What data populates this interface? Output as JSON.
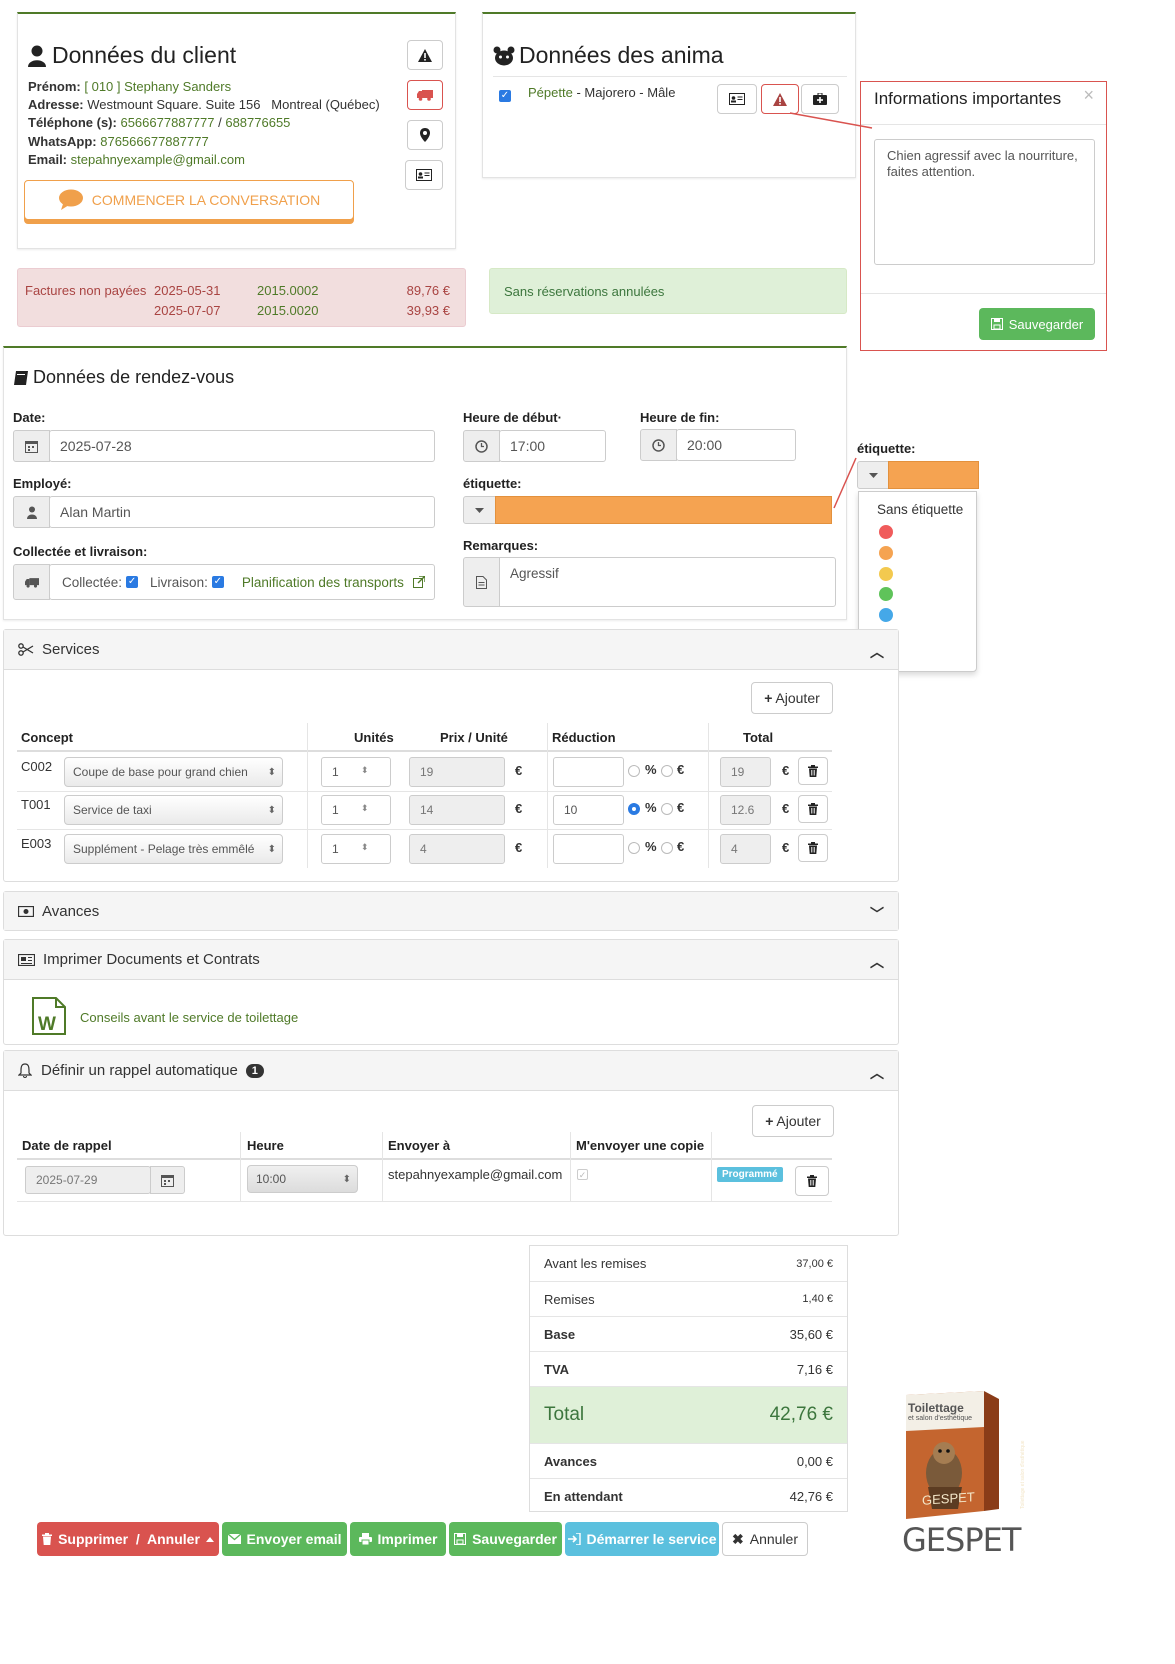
{
  "client": {
    "title": "Données du client",
    "prenom_label": "Prénom:",
    "prenom_value": "[ 010 ] Stephany Sanders",
    "adresse_label": "Adresse:",
    "adresse_value": "Westmount Square. Suite 156   Montreal (Québec)",
    "tel_label": "Téléphone (s):",
    "tel1": "6566677887777",
    "tel_sep": "/",
    "tel2": "688776655",
    "whatsapp_label": "WhatsApp:",
    "whatsapp_value": "876566677887777",
    "email_label": "Email:",
    "email_value": "stepahnyexample@gmail.com",
    "conversation_button": "COMMENCER LA CONVERSATION"
  },
  "animals": {
    "title": "Données des anima",
    "pet_name": "Pépette",
    "pet_details": "- Majorero - Mâle"
  },
  "important": {
    "title": "Informations importantes",
    "close": "×",
    "note": "Chien agressif avec la nourriture, faites attention.",
    "save_button": "Sauvegarder"
  },
  "invoices": {
    "label": "Factures non payées",
    "rows": [
      {
        "date": "2025-05-31",
        "number": "2015.0002",
        "amount": "89,76 €"
      },
      {
        "date": "2025-07-07",
        "number": "2015.0020",
        "amount": "39,93 €"
      }
    ]
  },
  "cancellations": {
    "text": "Sans réservations annulées"
  },
  "appointment": {
    "title": "Données de rendez-vous",
    "date_label": "Date:",
    "date_value": "2025-07-28",
    "start_label": "Heure de début·",
    "start_value": "17:00",
    "end_label": "Heure de fin:",
    "end_value": "20:00",
    "employee_label": "Employé:",
    "employee_value": "Alan Martin",
    "tag_label": "étiquette:",
    "tag_color": "#f5a351",
    "pickup_label": "Collectée et livraison:",
    "collected_label": "Collectée:",
    "delivery_label": "Livraison:",
    "transport_link": "Planification des transports",
    "remarks_label": "Remarques:",
    "remarks_value": "Agressif"
  },
  "tag_dropdown": {
    "label": "étiquette:",
    "none_option": "Sans étiquette",
    "colors": [
      "#f05b5b",
      "#f5a351",
      "#f3c94f",
      "#5fc35a",
      "#45a8e8",
      "#d07ee0",
      "#9e9e9e"
    ]
  },
  "services": {
    "title": "Services",
    "add_button": "Ajouter",
    "headers": {
      "concept": "Concept",
      "units": "Unités",
      "unit_price": "Prix / Unité",
      "discount": "Réduction",
      "total": "Total"
    },
    "rows": [
      {
        "code": "C002",
        "service": "Coupe de base pour grand chien",
        "units": "1",
        "price": "19",
        "discount": "",
        "percent_selected": false,
        "total": "19"
      },
      {
        "code": "T001",
        "service": "Service de taxi",
        "units": "1",
        "price": "14",
        "discount": "10",
        "percent_selected": true,
        "total": "12.6"
      },
      {
        "code": "E003",
        "service": "Supplément - Pelage très emmêlé",
        "units": "1",
        "price": "4",
        "discount": "",
        "percent_selected": false,
        "total": "4"
      }
    ],
    "currency": "€",
    "percent": "%"
  },
  "advances": {
    "title": "Avances"
  },
  "documents": {
    "title": "Imprimer Documents et Contrats",
    "doc_link": "Conseils avant le service de toilettage"
  },
  "reminder": {
    "title": "Définir un rappel automatique",
    "badge": "1",
    "add_button": "Ajouter",
    "headers": {
      "date": "Date de rappel",
      "time": "Heure",
      "send_to": "Envoyer à",
      "copy": "M'envoyer une copie"
    },
    "row": {
      "date": "2025-07-29",
      "time": "10:00",
      "email": "stepahnyexample@gmail.com",
      "status": "Programmé"
    }
  },
  "summary": {
    "rows": [
      {
        "label": "Avant les remises",
        "value": "37,00 €"
      },
      {
        "label": "Remises",
        "value": "1,40 €"
      },
      {
        "label": "Base",
        "value": "35,60 €"
      },
      {
        "label": "TVA",
        "value": "7,16 €"
      }
    ],
    "total_label": "Total",
    "total_value": "42,76 €",
    "advances_label": "Avances",
    "advances_value": "0,00 €",
    "pending_label": "En attendant",
    "pending_value": "42,76 €"
  },
  "footer": {
    "delete": "Supprimer  /  Annuler",
    "email": "Envoyer email",
    "print": "Imprimer",
    "save": "Sauvegarder",
    "start": "Démarrer le service",
    "cancel": "Annuler"
  },
  "logo": {
    "box_title": "Toilettage",
    "box_subtitle": "et salon d'esthétique",
    "box_side": "Toilettage et salon d'esthétique",
    "brand": "GESPET"
  },
  "colors": {
    "accent_green": "#4f7a28",
    "danger": "#d9534f",
    "success": "#5cb85c",
    "info": "#5bc0de",
    "orange": "#f0a04b"
  }
}
